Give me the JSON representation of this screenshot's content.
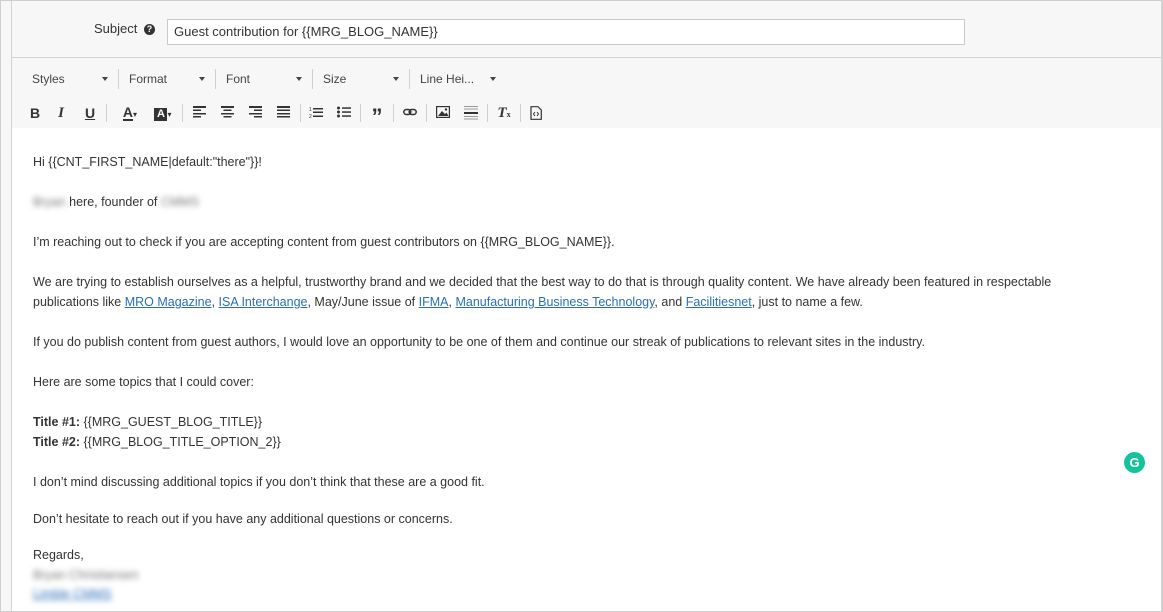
{
  "subject": {
    "label": "Subject",
    "help_icon": "question-circle-icon",
    "value": "Guest contribution for {{MRG_BLOG_NAME}}"
  },
  "toolbar": {
    "combos": [
      "Styles",
      "Format",
      "Font",
      "Size",
      "Line Hei..."
    ],
    "buttons": [
      "bold",
      "italic",
      "underline",
      "text-color",
      "background-color",
      "align-left",
      "align-center",
      "align-right",
      "justify",
      "numbered-list",
      "bulleted-list",
      "blockquote",
      "link",
      "image",
      "horizontal-line",
      "remove-format",
      "source"
    ]
  },
  "email": {
    "greeting": "Hi {{CNT_FIRST_NAME|default:\"there\"}}!",
    "intro_blur_name": "Bryan",
    "intro_text": " here, founder of ",
    "intro_blur_company": "CMMS",
    "p_reaching": "I’m reaching out to check if you are accepting content from guest contributors on {{MRG_BLOG_NAME}}.",
    "p_trying_line1": "We are trying to establish ourselves as a helpful, trustworthy brand and we decided that the best way to do that is through quality content. We have already been featured in respectable",
    "p_trying_line2_a": "publications like ",
    "link_mro": "MRO Magazine",
    "comma1": ", ",
    "link_isa": "ISA Interchange",
    "p_trying_line2_b": ", May/June issue of ",
    "link_ifma": "IFMA",
    "comma2": ", ",
    "link_mbt": "Manufacturing Business Technology",
    "p_trying_line2_c": ", and ",
    "link_facilities": "Facilitiesnet",
    "p_trying_line2_d": ", just to name a few.",
    "p_publish": "If you do publish content from guest authors, I would love an opportunity to be one of them and continue our streak of publications to relevant sites in the industry.",
    "p_topics": "Here are some topics that I could cover:",
    "title1_label": "Title #1:",
    "title1_value": " {{MRG_GUEST_BLOG_TITLE}}",
    "title2_label": "Title #2:",
    "title2_value": " {{MRG_BLOG_TITLE_OPTION_2}}",
    "p_mind": "I don’t mind discussing additional topics if you don’t think that these are a good fit.",
    "p_hesitate": "Don’t hesitate to reach out if you have any additional questions or concerns.",
    "regards": "Regards,",
    "signature_name": "Bryan Christiansen",
    "signature_company": "Limble CMMS"
  },
  "grammarly": {
    "letter": "G",
    "color": "#15c39a"
  }
}
